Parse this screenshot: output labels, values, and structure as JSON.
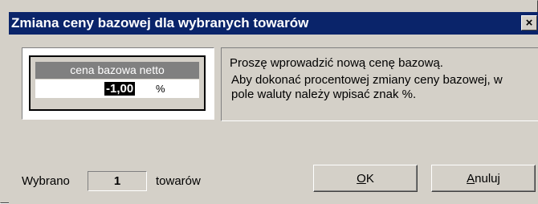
{
  "window": {
    "title": "Zmiana ceny bazowej dla wybranych towarów",
    "close_label": "×"
  },
  "price": {
    "label": "cena bazowa netto",
    "value": "-1,00",
    "unit": "%"
  },
  "info": {
    "line1": "Proszę wprowadzić nową cenę bazową.",
    "line2": "Aby dokonać procentowej zmiany ceny bazowej, w pole waluty należy wpisać znak %."
  },
  "selection": {
    "prefix": "Wybrano",
    "count": "1",
    "suffix": "towarów"
  },
  "buttons": {
    "ok_first": "O",
    "ok_rest": "K",
    "cancel_first": "A",
    "cancel_rest": "nuluj"
  },
  "colors": {
    "titlebar": "#0a246a",
    "face": "#d4d0c8",
    "label_bg": "#808080"
  }
}
